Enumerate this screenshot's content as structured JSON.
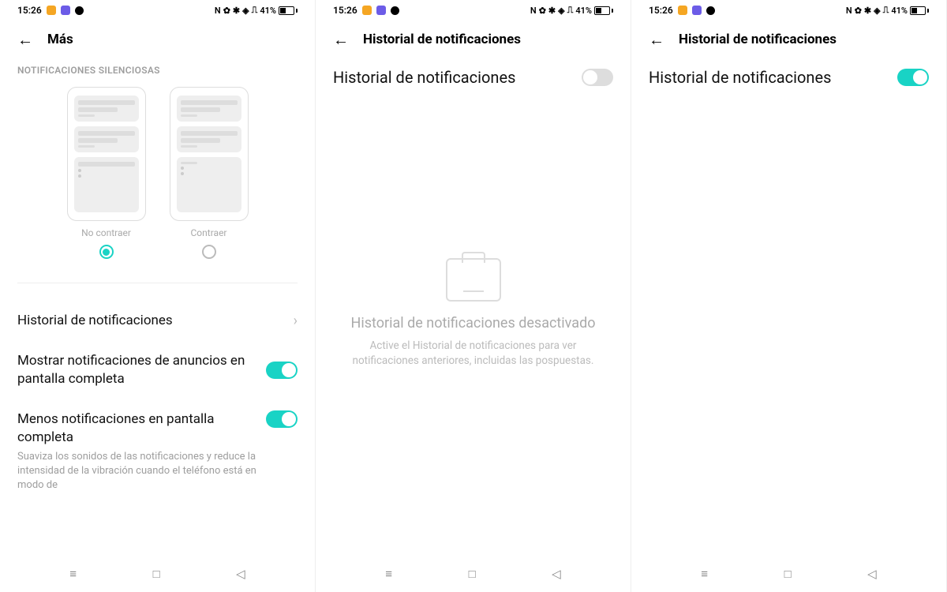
{
  "status": {
    "time": "15:26",
    "battery_pct": "41%",
    "icons_right": [
      "N",
      "🔕",
      "✱",
      "📶",
      "📶"
    ]
  },
  "screen1": {
    "title": "Más",
    "section_label": "NOTIFICACIONES SILENCIOSAS",
    "option_a": "No contraer",
    "option_b": "Contraer",
    "selected": "a",
    "row_history": "Historial de notificaciones",
    "row_ads_title": "Mostrar notificaciones de anuncios en pantalla completa",
    "row_ads_on": true,
    "row_less_title": "Menos notificaciones en pantalla completa",
    "row_less_sub": "Suaviza los sonidos de las notificaciones y reduce la intensidad de la vibración cuando el teléfono está en modo de",
    "row_less_on": true
  },
  "screen2": {
    "title": "Historial de notificaciones",
    "toggle_label": "Historial de notificaciones",
    "toggle_on": false,
    "empty_title": "Historial de notificaciones desactivado",
    "empty_sub": "Active el Historial de notificaciones para ver notificaciones anteriores, incluidas las pospuestas."
  },
  "screen3": {
    "title": "Historial de notificaciones",
    "toggle_label": "Historial de notificaciones",
    "toggle_on": true
  },
  "nav": {
    "recent": "≡",
    "home": "□",
    "back": "◁"
  }
}
